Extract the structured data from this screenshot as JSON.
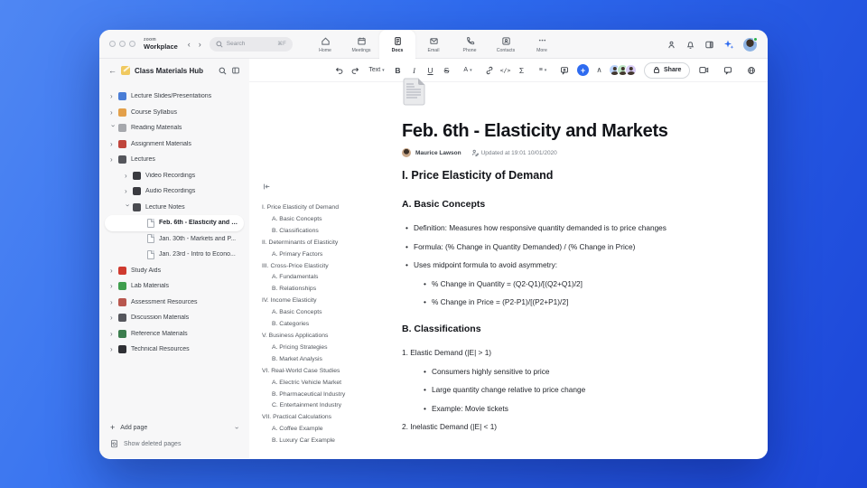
{
  "titlebar": {
    "logo_top": "zoom",
    "logo_bottom": "Workplace",
    "nav_prev": "‹",
    "nav_next": "›",
    "search_placeholder": "Search",
    "search_shortcut": "⌘F",
    "tabs": [
      {
        "label": "Home"
      },
      {
        "label": "Meetings"
      },
      {
        "label": "Docs"
      },
      {
        "label": "Email"
      },
      {
        "label": "Phone"
      },
      {
        "label": "Contacts"
      },
      {
        "label": "More"
      }
    ]
  },
  "sidebar": {
    "back": "←",
    "title": "Class Materials Hub",
    "items": [
      {
        "label": "Lecture Slides/Presentations",
        "cls": "l0",
        "chev": "›",
        "color": "#4a7dd6"
      },
      {
        "label": "Course Syllabus",
        "cls": "l0",
        "chev": "›",
        "color": "#e3a04a"
      },
      {
        "label": "Reading Materials",
        "cls": "l0 open",
        "chev": "›",
        "color": "#a6a8ad"
      },
      {
        "label": "Assignment Materials",
        "cls": "l0",
        "chev": "›",
        "color": "#c0463c"
      },
      {
        "label": "Lectures",
        "cls": "l0",
        "chev": "›",
        "color": "#55565c"
      },
      {
        "label": "Video Recordings",
        "cls": "l1",
        "chev": "›",
        "color": "#3a3b40"
      },
      {
        "label": "Audio Recordings",
        "cls": "l1",
        "chev": "›",
        "color": "#3a3b40"
      },
      {
        "label": "Lecture Notes",
        "cls": "l1 open",
        "chev": "›",
        "color": "#4a4b50"
      },
      {
        "label": "Feb. 6th - Elasticity and M...",
        "cls": "l2 page sel",
        "chev": "",
        "color": ""
      },
      {
        "label": "Jan. 30th - Markets and P...",
        "cls": "l2 page",
        "chev": "",
        "color": ""
      },
      {
        "label": "Jan. 23rd - Intro to Econo...",
        "cls": "l2 page",
        "chev": "",
        "color": ""
      },
      {
        "label": "Study Aids",
        "cls": "l0",
        "chev": "›",
        "color": "#cf3a2f"
      },
      {
        "label": "Lab Materials",
        "cls": "l0",
        "chev": "›",
        "color": "#3f9e4d"
      },
      {
        "label": "Assessment Resources",
        "cls": "l0",
        "chev": "›",
        "color": "#b8574e"
      },
      {
        "label": "Discussion Materials",
        "cls": "l0",
        "chev": "›",
        "color": "#55565c"
      },
      {
        "label": "Reference Materials",
        "cls": "l0",
        "chev": "›",
        "color": "#3c7d4e"
      },
      {
        "label": "Technical Resources",
        "cls": "l0",
        "chev": "›",
        "color": "#2f3035"
      }
    ],
    "add_page": "Add page",
    "add_chevron": "›",
    "show_deleted": "Show deleted pages"
  },
  "toolbar": {
    "text_label": "Text",
    "bold": "B",
    "italic": "I",
    "underline": "U",
    "strike": "S",
    "color": "A",
    "code": "</>",
    "formula": "Σ",
    "align": "≡",
    "caret": "▾",
    "collapse": "∧",
    "plus": "+",
    "share_label": "Share",
    "more": "⋯"
  },
  "toc": {
    "items": [
      {
        "t": "I. Price Elasticity of Demand",
        "cls": "t1"
      },
      {
        "t": "A. Basic Concepts",
        "cls": "t2"
      },
      {
        "t": "B. Classifications",
        "cls": "t2"
      },
      {
        "t": "II. Determinants of Elasticity",
        "cls": "t1"
      },
      {
        "t": "A. Primary Factors",
        "cls": "t2"
      },
      {
        "t": "III. Cross-Price Elasticity",
        "cls": "t1"
      },
      {
        "t": "A. Fundamentals",
        "cls": "t2"
      },
      {
        "t": "B. Relationships",
        "cls": "t2"
      },
      {
        "t": "IV. Income Elasticity",
        "cls": "t1"
      },
      {
        "t": "A. Basic Concepts",
        "cls": "t2"
      },
      {
        "t": "B. Categories",
        "cls": "t2"
      },
      {
        "t": "V. Business Applications",
        "cls": "t1"
      },
      {
        "t": "A. Pricing Strategies",
        "cls": "t2"
      },
      {
        "t": "B. Market Analysis",
        "cls": "t2"
      },
      {
        "t": "VI. Real-World Case Studies",
        "cls": "t1"
      },
      {
        "t": "A. Electric Vehicle Market",
        "cls": "t2"
      },
      {
        "t": "B. Pharmaceutical Industry",
        "cls": "t2"
      },
      {
        "t": "C. Entertainment Industry",
        "cls": "t2"
      },
      {
        "t": "VII. Practical Calculations",
        "cls": "t1"
      },
      {
        "t": "A. Coffee Example",
        "cls": "t2"
      },
      {
        "t": "B. Luxury Car Example",
        "cls": "t2"
      }
    ]
  },
  "doc": {
    "title": "Feb. 6th - Elasticity and Markets",
    "author": "Maurice Lawson",
    "updated": "Updated at 19:01 10/01/2020",
    "sections": [
      {
        "cls": "h2",
        "text": "I. Price Elasticity of Demand"
      },
      {
        "cls": "h3",
        "text": "A. Basic Concepts"
      },
      {
        "cls": "b1",
        "text": "Definition: Measures how responsive quantity demanded is to price changes"
      },
      {
        "cls": "b1",
        "text": "Formula: (% Change in Quantity Demanded) / (% Change in Price)"
      },
      {
        "cls": "b1",
        "text": "Uses midpoint formula to avoid asymmetry:"
      },
      {
        "cls": "b2",
        "text": "% Change in Quantity = (Q2-Q1)/[(Q2+Q1)/2]"
      },
      {
        "cls": "b2",
        "text": "% Change in Price = (P2-P1)/[(P2+P1)/2]"
      },
      {
        "cls": "h3",
        "text": "B. Classifications"
      },
      {
        "cls": "n1",
        "text": "1. Elastic Demand (|E| > 1)"
      },
      {
        "cls": "b2",
        "text": "Consumers highly sensitive to price"
      },
      {
        "cls": "b2",
        "text": "Large quantity change relative to price change"
      },
      {
        "cls": "b2",
        "text": "Example: Movie tickets"
      },
      {
        "cls": "n1",
        "text": "2. Inelastic Demand (|E| < 1)"
      }
    ]
  }
}
